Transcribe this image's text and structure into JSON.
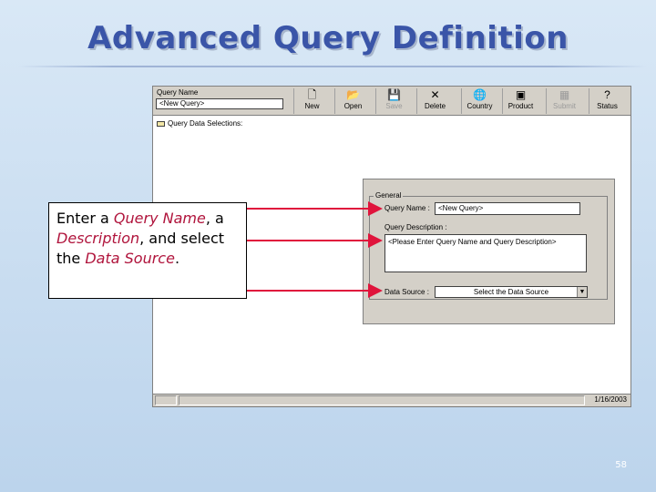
{
  "slide": {
    "title": "Advanced Query Definition",
    "page_number": "58"
  },
  "toolbar": {
    "query_name_label": "Query Name",
    "query_name_value": "<New Query>",
    "buttons": [
      {
        "label": "New",
        "icon": "new-document-icon",
        "glyph": "🗋",
        "enabled": true
      },
      {
        "label": "Open",
        "icon": "open-folder-icon",
        "glyph": "📂",
        "enabled": true
      },
      {
        "label": "Save",
        "icon": "floppy-disk-icon",
        "glyph": "💾",
        "enabled": false
      },
      {
        "label": "Delete",
        "icon": "delete-x-icon",
        "glyph": "✕",
        "enabled": true
      },
      {
        "label": "Country",
        "icon": "globe-icon",
        "glyph": "🌐",
        "enabled": true
      },
      {
        "label": "Product",
        "icon": "product-icon",
        "glyph": "▣",
        "enabled": true
      },
      {
        "label": "Submit",
        "icon": "submit-icon",
        "glyph": "▦",
        "enabled": false
      },
      {
        "label": "Status",
        "icon": "help-question-icon",
        "glyph": "?",
        "enabled": true
      }
    ]
  },
  "tree": {
    "item_label": "Query Data Selections:"
  },
  "statusbar": {
    "date": "1/16/2003"
  },
  "general_panel": {
    "group_label": "General",
    "query_name_label": "Query Name :",
    "query_name_value": "<New Query>",
    "description_label": "Query Description :",
    "description_value": "<Please Enter Query Name and Query Description>",
    "data_source_label": "Data Source :",
    "data_source_value": "Select the Data Source"
  },
  "callout": {
    "t1": "Enter a ",
    "e1": "Query Name",
    "t2": ", a ",
    "e2": "Description",
    "t3": ", and select the ",
    "e3": "Data Source",
    "t4": "."
  },
  "colors": {
    "title": "#3a55a8",
    "arrow": "#e0143c",
    "emphasis": "#b0143c",
    "window_chrome": "#d4d0c8"
  }
}
